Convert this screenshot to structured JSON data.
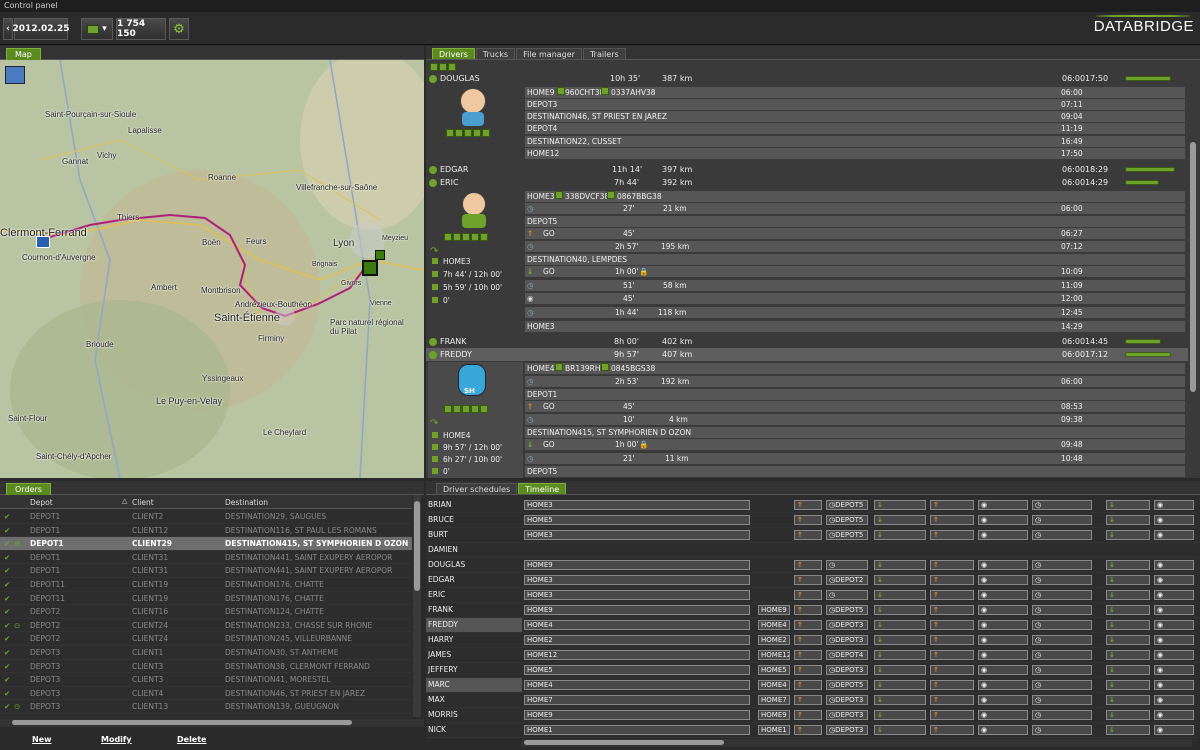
{
  "window": {
    "title": "Control panel"
  },
  "toolbar": {
    "date": "2012.02.25",
    "count": "1 754 150",
    "brand": "DATABRIDGE"
  },
  "map_panel": {
    "tab": "Map",
    "labels": [
      "Saint-Pourçain-sur-Sioule",
      "Lapalisse",
      "Gannat",
      "Vichy",
      "Roanne",
      "Villefranche-sur-Saône",
      "Clermont-Ferrand",
      "Cournon-d'Auvergne",
      "Thiers",
      "Boën",
      "Feurs",
      "Lyon",
      "Meyzieu",
      "Brignais",
      "Givors",
      "Vienne",
      "Montbrison",
      "Andrézieux-Bouthéon",
      "Saint-Étienne",
      "Firminy",
      "Parc naturel régional du Pilat",
      "Ambert",
      "Brioude",
      "Yssingeaux",
      "Le Puy-en-Velay",
      "Saint-Flour",
      "Le Cheylard",
      "Saint-Chély-d'Apcher"
    ]
  },
  "drivers_panel": {
    "tabs": [
      "Drivers",
      "Trucks",
      "File manager",
      "Trailers"
    ],
    "rows": [
      {
        "name": "DOUGLAS",
        "time": "10h 35'",
        "km": "387 km",
        "start": "06:00",
        "end": "17:50"
      },
      {
        "name": "EDGAR",
        "time": "11h 14'",
        "km": "397 km",
        "start": "06:00",
        "end": "18:29"
      },
      {
        "name": "ERIC",
        "time": "7h 44'",
        "km": "392 km",
        "start": "06:00",
        "end": "14:29"
      },
      {
        "name": "FRANK",
        "time": "8h 00'",
        "km": "402 km",
        "start": "06:00",
        "end": "14:45"
      },
      {
        "name": "FREDDY",
        "time": "9h 57'",
        "km": "407 km",
        "start": "06:00",
        "end": "17:12"
      }
    ],
    "douglas_stops": [
      {
        "label": "HOME9",
        "plate1": "960CHT38",
        "plate2": "0337AHV38",
        "time": "06:00"
      },
      {
        "label": "DEPOT3",
        "time": "07:11"
      },
      {
        "label": "DESTINATION46, ST PRIEST EN JAREZ",
        "time": "09:04"
      },
      {
        "label": "DEPOT4",
        "time": "11:19"
      },
      {
        "label": "DESTINATION22, CUSSET",
        "time": "16:49"
      },
      {
        "label": "HOME12",
        "time": "17:50"
      }
    ],
    "eric_stops": [
      {
        "label": "HOME3",
        "plate1": "338DVCF38",
        "plate2": "0867BBG38",
        "time": ""
      },
      {
        "label": "",
        "dur": "27'",
        "km": "21 km",
        "time": "06:00"
      },
      {
        "label": "DEPOT5",
        "time": ""
      },
      {
        "label": "GO",
        "dur": "45'",
        "km": "",
        "time": "06:27"
      },
      {
        "label": "",
        "dur": "2h 57'",
        "km": "195 km",
        "time": "07:12"
      },
      {
        "label": "DESTINATION40, LEMPDES",
        "time": ""
      },
      {
        "label": "GO",
        "dur": "1h 00'",
        "km": "",
        "time": "10:09"
      },
      {
        "label": "",
        "dur": "51'",
        "km": "58 km",
        "time": "11:09"
      },
      {
        "label": "",
        "dur": "45'",
        "km": "",
        "time": "12:00"
      },
      {
        "label": "",
        "dur": "1h 44'",
        "km": "118 km",
        "time": "12:45"
      },
      {
        "label": "HOME3",
        "time": "14:29"
      }
    ],
    "eric_side": {
      "home": "HOME3",
      "drive": "7h 44' / 12h 00'",
      "work": "5h 59' / 10h 00'",
      "rest": "0'"
    },
    "freddy_stops": [
      {
        "label": "HOME4",
        "plate1": "BR139RH",
        "plate2": "0845BGS38",
        "time": ""
      },
      {
        "label": "",
        "dur": "2h 53'",
        "km": "192 km",
        "time": "06:00"
      },
      {
        "label": "DEPOT1",
        "time": ""
      },
      {
        "label": "GO",
        "dur": "45'",
        "km": "",
        "time": "08:53"
      },
      {
        "label": "",
        "dur": "10'",
        "km": "4 km",
        "time": "09:38"
      },
      {
        "label": "DESTINATION415, ST SYMPHORIEN D OZON",
        "time": ""
      },
      {
        "label": "GO",
        "dur": "1h 00'",
        "km": "",
        "time": "09:48"
      },
      {
        "label": "",
        "dur": "21'",
        "km": "11 km",
        "time": "10:48"
      },
      {
        "label": "DEPOT5",
        "time": ""
      }
    ],
    "freddy_side": {
      "home": "HOME4",
      "drive": "9h 57' / 12h 00'",
      "work": "6h 27' / 10h 00'",
      "rest": "0'"
    },
    "avatar_badge": "SH"
  },
  "orders_panel": {
    "tab": "Orders",
    "columns": [
      "Depot",
      "Client",
      "Destination"
    ],
    "rows": [
      {
        "depot": "DEPOT1",
        "client": "CLIENT2",
        "dest": "DESTINATION29, SAUGUES"
      },
      {
        "depot": "DEPOT1",
        "client": "CLIENT12",
        "dest": "DESTINATION116, ST PAUL LES ROMANS"
      },
      {
        "depot": "DEPOT1",
        "client": "CLIENT29",
        "dest": "DESTINATION415, ST SYMPHORIEN D OZON"
      },
      {
        "depot": "DEPOT1",
        "client": "CLIENT31",
        "dest": "DESTINATION441, SAINT EXUPERY AEROPOR"
      },
      {
        "depot": "DEPOT1",
        "client": "CLIENT31",
        "dest": "DESTINATION441, SAINT EXUPERY AEROPOR"
      },
      {
        "depot": "DEPOT11",
        "client": "CLIENT19",
        "dest": "DESTINATION176, CHATTE"
      },
      {
        "depot": "DEPOT11",
        "client": "CLIENT19",
        "dest": "DESTINATION176, CHATTE"
      },
      {
        "depot": "DEPOT2",
        "client": "CLIENT16",
        "dest": "DESTINATION124, CHATTE"
      },
      {
        "depot": "DEPOT2",
        "client": "CLIENT24",
        "dest": "DESTINATION233, CHASSE SUR RHONE"
      },
      {
        "depot": "DEPOT2",
        "client": "CLIENT24",
        "dest": "DESTINATION245, VILLEURBANNE"
      },
      {
        "depot": "DEPOT3",
        "client": "CLIENT1",
        "dest": "DESTINATION30, ST ANTHEME"
      },
      {
        "depot": "DEPOT3",
        "client": "CLIENT3",
        "dest": "DESTINATION38, CLERMONT FERRAND"
      },
      {
        "depot": "DEPOT3",
        "client": "CLIENT3",
        "dest": "DESTINATION41, MORESTEL"
      },
      {
        "depot": "DEPOT3",
        "client": "CLIENT4",
        "dest": "DESTINATION46, ST PRIEST EN JAREZ"
      },
      {
        "depot": "DEPOT3",
        "client": "CLIENT13",
        "dest": "DESTINATION139, GUEUGNON"
      }
    ],
    "buttons": {
      "new": "New",
      "modify": "Modify",
      "delete": "Delete"
    }
  },
  "timeline_panel": {
    "tabs": [
      "Driver schedules",
      "Timeline"
    ],
    "drivers": [
      "BRIAN",
      "BRUCE",
      "BURT",
      "DAMIEN",
      "DOUGLAS",
      "EDGAR",
      "ERIC",
      "FRANK",
      "FREDDY",
      "HARRY",
      "JAMES",
      "JEFFERY",
      "MARC",
      "MAX",
      "MORRIS",
      "NICK"
    ],
    "first_blocks": [
      "HOME3",
      "HOME5",
      "HOME3",
      "",
      "HOME9",
      "HOME3",
      "HOME3",
      "HOME9",
      "HOME4",
      "HOME2",
      "HOME12",
      "HOME5",
      "HOME4",
      "HOME7",
      "HOME9",
      "HOME1"
    ],
    "second_blocks": [
      "",
      "",
      "",
      "",
      "",
      "",
      "",
      "HOME9",
      "HOME4",
      "HOME2",
      "HOME12",
      "HOME5",
      "HOME4",
      "HOME7",
      "HOME9",
      "HOME1"
    ],
    "depot_labels": [
      "DEPOT5",
      "DEPOT5",
      "DEPOT5",
      "",
      "",
      "DEPOT2",
      "",
      "DEPOT5",
      "DEPOT3",
      "DEPOT3",
      "DEPOT4",
      "DEPOT3",
      "DEPOT5",
      "DEPOT3",
      "DEPOT3",
      "DEPOT3"
    ]
  }
}
